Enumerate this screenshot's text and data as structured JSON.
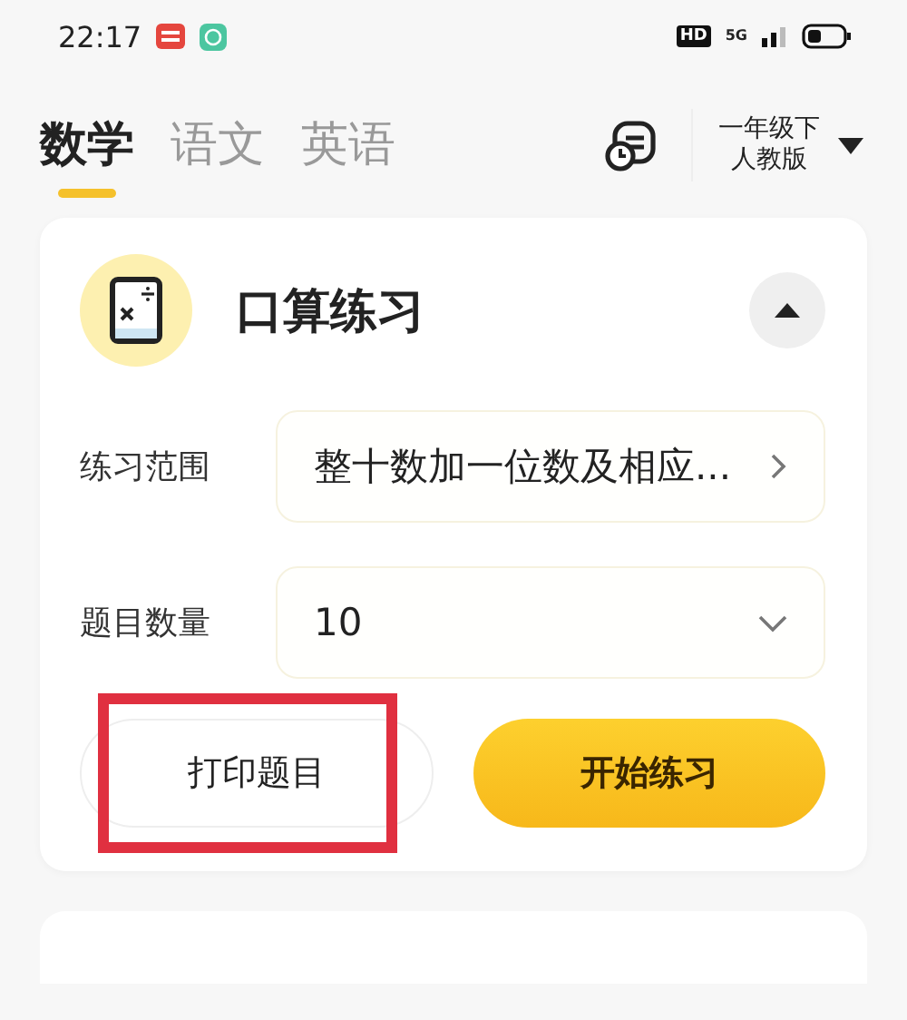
{
  "status_bar": {
    "time": "22:17",
    "network": "5G",
    "hd": "HD"
  },
  "tabs": [
    {
      "label": "数学",
      "selected": true
    },
    {
      "label": "语文",
      "selected": false
    },
    {
      "label": "英语",
      "selected": false
    }
  ],
  "grade_selector": {
    "grade": "一年级下",
    "edition": "人教版"
  },
  "card": {
    "title": "口算练习",
    "expanded": true,
    "fields": [
      {
        "label": "练习范围",
        "value": "整十数加一位数及相应...",
        "kind": "link"
      },
      {
        "label": "题目数量",
        "value": "10",
        "kind": "dropdown"
      }
    ],
    "buttons": [
      {
        "label": "打印题目",
        "kind": "outline",
        "highlighted": true
      },
      {
        "label": "开始练习",
        "kind": "primary",
        "highlighted": false
      }
    ]
  }
}
